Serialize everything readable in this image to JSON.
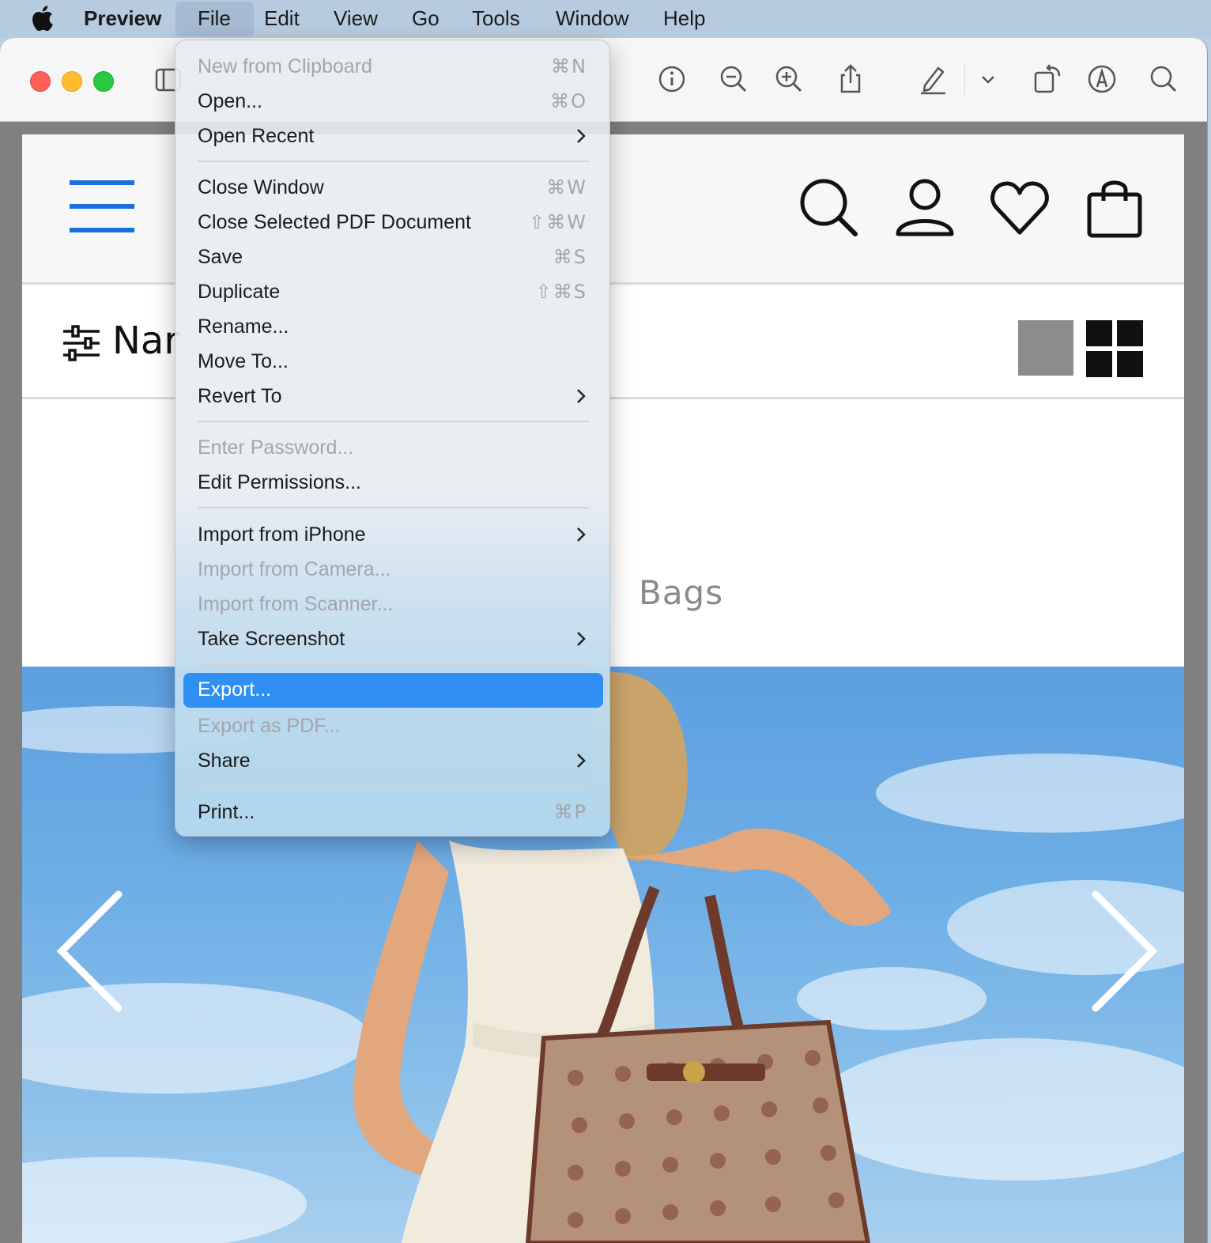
{
  "menubar": {
    "apple_icon": "apple-logo-icon",
    "app_name": "Preview",
    "items": [
      "File",
      "Edit",
      "View",
      "Go",
      "Tools",
      "Window",
      "Help"
    ]
  },
  "file_menu": {
    "items": [
      {
        "label": "New from Clipboard",
        "shortcut": "⌘N",
        "disabled": true
      },
      {
        "label": "Open...",
        "shortcut": "⌘O"
      },
      {
        "label": "Open Recent",
        "submenu": true
      },
      {
        "label": "Close Window",
        "shortcut": "⌘W"
      },
      {
        "label": "Close Selected PDF Document",
        "shortcut": "⇧⌘W"
      },
      {
        "label": "Save",
        "shortcut": "⌘S"
      },
      {
        "label": "Duplicate",
        "shortcut": "⇧⌘S"
      },
      {
        "label": "Rename..."
      },
      {
        "label": "Move To..."
      },
      {
        "label": "Revert To",
        "submenu": true
      },
      {
        "label": "Enter Password...",
        "disabled": true
      },
      {
        "label": "Edit Permissions..."
      },
      {
        "label": "Import from iPhone",
        "submenu": true
      },
      {
        "label": "Import from Camera...",
        "disabled": true
      },
      {
        "label": "Import from Scanner...",
        "disabled": true
      },
      {
        "label": "Take Screenshot",
        "submenu": true
      },
      {
        "label": "Export...",
        "highlighted": true
      },
      {
        "label": "Export as PDF...",
        "disabled": true
      },
      {
        "label": "Share",
        "submenu": true
      },
      {
        "label": "Print...",
        "shortcut": "⌘P"
      }
    ]
  },
  "toolbar": {
    "icons": [
      "sidebar-icon",
      "info-icon",
      "zoom-out-icon",
      "zoom-in-icon",
      "share-icon",
      "markup-pen-icon",
      "chevron-down-icon",
      "rotate-icon",
      "annotate-icon",
      "search-icon"
    ]
  },
  "document": {
    "header_icons": [
      "hamburger-menu-icon",
      "search-icon",
      "account-icon",
      "wishlist-heart-icon",
      "shopping-bag-icon"
    ],
    "filter_label": "Nar",
    "category_title": "Bags",
    "accent_color": "#1a6fe0"
  },
  "colors": {
    "menu_highlight": "#2f8ff3",
    "menubar_bg": "#b6cbdf"
  }
}
